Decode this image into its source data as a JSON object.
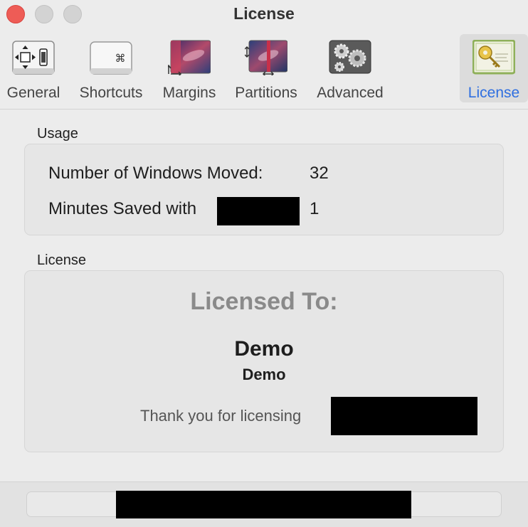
{
  "window": {
    "title": "License"
  },
  "toolbar": {
    "tabs": [
      {
        "label": "General",
        "icon": "move-arrows-icon"
      },
      {
        "label": "Shortcuts",
        "icon": "command-key-icon"
      },
      {
        "label": "Margins",
        "icon": "galaxy-margins-icon"
      },
      {
        "label": "Partitions",
        "icon": "galaxy-partitions-icon"
      },
      {
        "label": "Advanced",
        "icon": "gears-icon"
      },
      {
        "label": "License",
        "icon": "key-certificate-icon",
        "selected": true
      }
    ]
  },
  "usage": {
    "section_label": "Usage",
    "windows_moved_label": "Number of Windows Moved:",
    "windows_moved_value": "32",
    "minutes_saved_label": "Minutes Saved with",
    "minutes_saved_value": "1"
  },
  "license": {
    "section_label": "License",
    "heading": "Licensed To:",
    "name": "Demo",
    "organization": "Demo",
    "thanks": "Thank you for licensing"
  },
  "colors": {
    "accent": "#2f6fe0",
    "close": "#ee5c56",
    "redaction": "#000000"
  }
}
